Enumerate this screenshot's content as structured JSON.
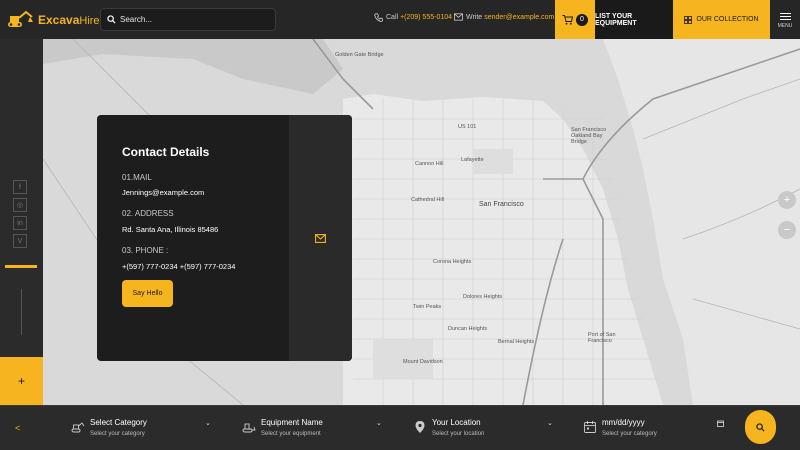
{
  "brand": {
    "name_part1": "Excava",
    "name_part2": "Hire"
  },
  "header": {
    "search_placeholder": "Search...",
    "call_label": "Call",
    "call_number": "+(209) 555-0104",
    "write_label": "Write",
    "write_email": "sender@example.com",
    "cart_count": "0",
    "list_equipment": "LIST YOUR EQUIPMENT",
    "our_collection": "OUR COLLECTION",
    "menu_label": "MENU"
  },
  "sidebar": {
    "social": [
      {
        "icon": "facebook-icon",
        "glyph": "f"
      },
      {
        "icon": "instagram-icon",
        "glyph": "◎"
      },
      {
        "icon": "linkedin-icon",
        "glyph": "in"
      },
      {
        "icon": "vimeo-icon",
        "glyph": "V"
      }
    ],
    "add_glyph": "+"
  },
  "map": {
    "labels": {
      "golden_gate": "Golden Gate Bridge",
      "san_francisco": "San Francisco",
      "sf_oakland": "San Francisco Oakland Bay Bridge",
      "us101": "US 101",
      "port": "Port of San Francisco",
      "lafayette": "Lafayette",
      "cathedral": "Cathedral Hill",
      "corona": "Corona Heights",
      "twin_peaks": "Twin Peaks",
      "dolores": "Dolores Heights",
      "bernal": "Bernal Heights",
      "duncan": "Duncan Heights",
      "cannon": "Cannon Hill",
      "mount_davidson": "Mount Davidson"
    }
  },
  "contact": {
    "title": "Contact Details",
    "mail_label": "01.MAIL",
    "mail_value": "Jennings@example.com",
    "address_label": "02. ADDRESS",
    "address_value": "Rd. Santa Ana, Illinois 85486",
    "phone_label": "03. PHONE :",
    "phone_value": "+(597) 777-0234 +(597) 777-0234",
    "cta": "Say Hello"
  },
  "filters": [
    {
      "title": "Select Category",
      "sub": "Select your category"
    },
    {
      "title": "Equipment Name",
      "sub": "Select your equipment"
    },
    {
      "title": "Your Location",
      "sub": "Select your location"
    },
    {
      "title": "mm/dd/yyyy",
      "sub": "Select your category"
    }
  ],
  "colors": {
    "accent": "#f6b51e",
    "dark": "#1d1d1d",
    "panel": "#2b2b2b"
  }
}
